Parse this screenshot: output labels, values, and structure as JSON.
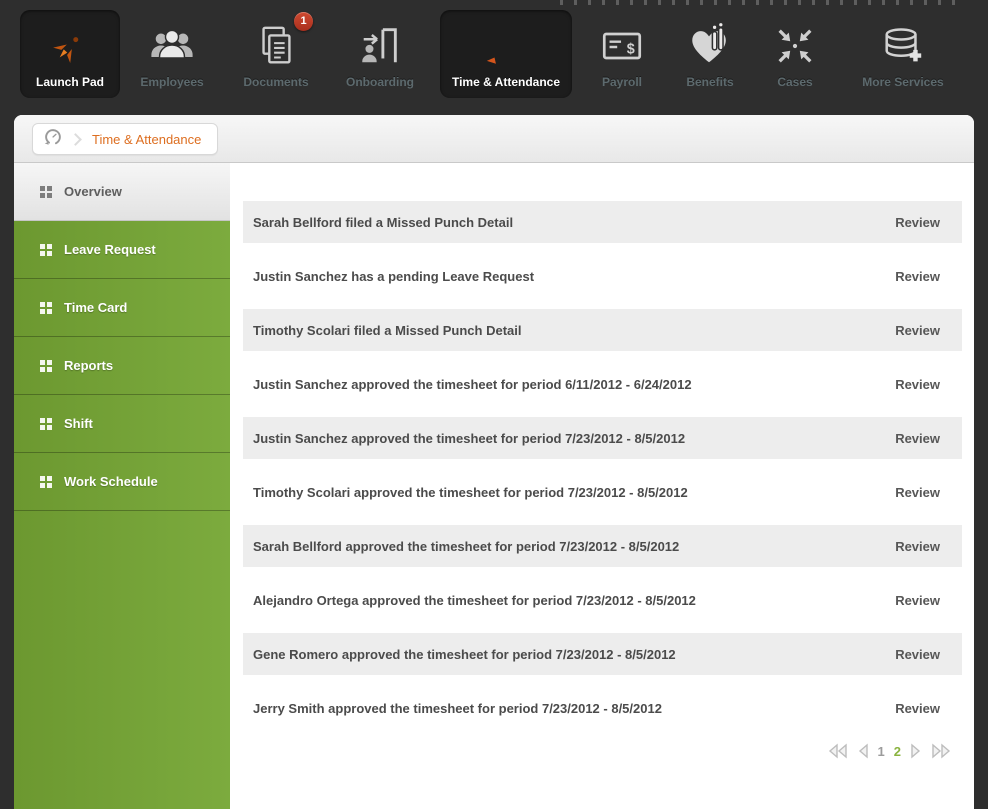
{
  "topnav": {
    "items": [
      {
        "label": "Launch Pad",
        "icon": "rocket-icon",
        "active": true
      },
      {
        "label": "Employees",
        "icon": "employees-icon",
        "active": false
      },
      {
        "label": "Documents",
        "icon": "documents-icon",
        "active": false,
        "badge": "1"
      },
      {
        "label": "Onboarding",
        "icon": "onboarding-icon",
        "active": false
      },
      {
        "label": "Time & Attendance",
        "icon": "time-clock-icon",
        "active": true
      },
      {
        "label": "Payroll",
        "icon": "payroll-check-icon",
        "active": false
      },
      {
        "label": "Benefits",
        "icon": "benefits-heart-icon",
        "active": false
      },
      {
        "label": "Cases",
        "icon": "cases-arrows-icon",
        "active": false
      },
      {
        "label": "More Services",
        "icon": "more-services-database-icon",
        "active": false
      }
    ]
  },
  "breadcrumb": {
    "icon": "history-clock-icon",
    "label": "Time & Attendance"
  },
  "sidebar": {
    "items": [
      {
        "label": "Overview",
        "active": true
      },
      {
        "label": "Leave Request",
        "active": false
      },
      {
        "label": "Time Card",
        "active": false
      },
      {
        "label": "Reports",
        "active": false
      },
      {
        "label": "Shift",
        "active": false
      },
      {
        "label": "Work Schedule",
        "active": false
      }
    ]
  },
  "activity": {
    "review_label": "Review",
    "rows": [
      "Sarah Bellford filed a Missed Punch Detail",
      "Justin Sanchez has a pending Leave Request",
      "Timothy Scolari filed a Missed Punch Detail",
      "Justin Sanchez approved the timesheet for period 6/11/2012 - 6/24/2012",
      "Justin Sanchez approved the timesheet for period 7/23/2012 - 8/5/2012",
      "Timothy Scolari approved the timesheet for period 7/23/2012 - 8/5/2012",
      "Sarah Bellford approved the timesheet for period 7/23/2012 - 8/5/2012",
      "Alejandro Ortega approved the timesheet for period 7/23/2012 - 8/5/2012",
      "Gene Romero approved the timesheet for period 7/23/2012 - 8/5/2012",
      "Jerry Smith approved the timesheet for period 7/23/2012 - 8/5/2012"
    ]
  },
  "pagination": {
    "pages": [
      "1",
      "2"
    ],
    "current_page": "2"
  },
  "colors": {
    "accent_orange": "#dd6e20",
    "brand_green": "#76a337",
    "badge_red": "#bf3b2a",
    "active_page_green": "#8ab33f",
    "nav_bg": "#2e2e2e",
    "nav_tile_bg": "#1d1d1d",
    "row_shade": "#ededed"
  }
}
